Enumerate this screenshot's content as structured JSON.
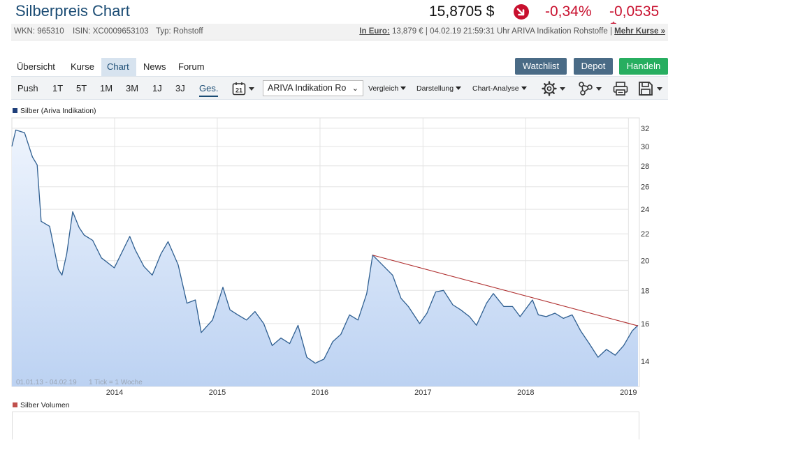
{
  "header": {
    "title": "Silberpreis Chart",
    "price": "15,8705 $",
    "change_pct": "-0,34%",
    "change_abs": "-0,0535 $",
    "trend_icon": "arrow-down-circle-icon",
    "trend_color": "#c8102e"
  },
  "info": {
    "wkn": "WKN: 965310",
    "isin": "ISIN: XC0009653103",
    "typ": "Typ: Rohstoff",
    "in_euro_label": "In Euro:",
    "in_euro_text": "13,879 € | 04.02.19 21:59:31 Uhr ARIVA Indikation Rohstoffe |",
    "mehr_kurse": "Mehr Kurse »"
  },
  "nav": {
    "tabs": [
      "Übersicht",
      "Kurse",
      "Chart",
      "News",
      "Forum"
    ],
    "active": "Chart"
  },
  "actions": {
    "watchlist": "Watchlist",
    "depot": "Depot",
    "handeln": "Handeln"
  },
  "toolbar": {
    "push": "Push",
    "ranges": [
      "1T",
      "5T",
      "1M",
      "3M",
      "1J",
      "3J",
      "Ges."
    ],
    "active_range": "Ges.",
    "calendar_day": "21",
    "source": "ARIVA Indikation Ro",
    "vergleich": "Vergleich",
    "darstellung": "Darstellung",
    "chart_analyse": "Chart-Analyse"
  },
  "footer_note": {
    "range": "01.01.13 - 04.02.19",
    "tick": "1 Tick = 1 Woche"
  },
  "colors": {
    "line": "#2f5f91",
    "fill_top": "#eef4fd",
    "fill_bottom": "#bcd2f2",
    "trendline": "#b03030",
    "silber_swatch": "#1f3f7a",
    "volumen_swatch": "#c0504d"
  },
  "chart_data": {
    "type": "area",
    "title": "",
    "series": [
      {
        "name": "Silber (Ariva Indikation)",
        "x": [
          "2013-01-01",
          "2013-01-15",
          "2013-02-15",
          "2013-03-15",
          "2013-04-01",
          "2013-04-15",
          "2013-05-15",
          "2013-06-15",
          "2013-06-28",
          "2013-07-15",
          "2013-08-05",
          "2013-08-28",
          "2013-09-15",
          "2013-10-15",
          "2013-11-15",
          "2013-12-31",
          "2014-01-15",
          "2014-02-24",
          "2014-03-15",
          "2014-04-15",
          "2014-05-15",
          "2014-06-15",
          "2014-07-10",
          "2014-08-15",
          "2014-09-15",
          "2014-10-15",
          "2014-11-05",
          "2014-12-15",
          "2015-01-21",
          "2015-02-15",
          "2015-03-15",
          "2015-04-15",
          "2015-05-15",
          "2015-06-15",
          "2015-07-15",
          "2015-08-15",
          "2015-09-15",
          "2015-10-15",
          "2015-11-15",
          "2015-12-15",
          "2016-01-15",
          "2016-02-15",
          "2016-03-15",
          "2016-04-15",
          "2016-05-15",
          "2016-06-15",
          "2016-07-06",
          "2016-08-15",
          "2016-09-15",
          "2016-10-15",
          "2016-11-10",
          "2016-12-20",
          "2017-01-15",
          "2017-02-15",
          "2017-03-15",
          "2017-04-17",
          "2017-05-15",
          "2017-06-15",
          "2017-07-10",
          "2017-08-15",
          "2017-09-08",
          "2017-10-15",
          "2017-11-15",
          "2017-12-12",
          "2018-01-25",
          "2018-02-15",
          "2018-03-15",
          "2018-04-15",
          "2018-05-15",
          "2018-06-15",
          "2018-07-15",
          "2018-08-15",
          "2018-09-15",
          "2018-10-15",
          "2018-11-15",
          "2018-12-15",
          "2019-01-15",
          "2019-02-04"
        ],
        "values": [
          30.0,
          31.8,
          31.5,
          28.9,
          28.1,
          23.0,
          22.6,
          19.4,
          19.0,
          20.5,
          23.8,
          22.5,
          21.9,
          21.5,
          20.2,
          19.5,
          20.1,
          21.8,
          20.8,
          19.6,
          19.0,
          20.5,
          21.4,
          19.7,
          17.2,
          17.4,
          15.5,
          16.2,
          18.2,
          16.8,
          16.5,
          16.2,
          16.7,
          16.0,
          14.8,
          15.2,
          14.9,
          15.9,
          14.2,
          13.9,
          14.1,
          15.0,
          15.4,
          16.5,
          16.2,
          17.8,
          20.4,
          19.6,
          19.0,
          17.5,
          17.0,
          16.0,
          16.6,
          17.9,
          18.0,
          17.1,
          16.8,
          16.4,
          15.9,
          17.2,
          17.8,
          17.0,
          17.0,
          16.4,
          17.4,
          16.5,
          16.4,
          16.6,
          16.3,
          16.5,
          15.6,
          14.9,
          14.2,
          14.6,
          14.3,
          14.8,
          15.6,
          15.9
        ]
      }
    ],
    "xlabel": "",
    "ylabel": "",
    "x_ticks": [
      "2014",
      "2015",
      "2016",
      "2017",
      "2018",
      "2019"
    ],
    "y_ticks": [
      14,
      16,
      18,
      20,
      22,
      24,
      26,
      28,
      30,
      32
    ],
    "ylim": [
      12.8,
      33.2
    ],
    "y_scale": "log",
    "xlim": [
      "2013-01-01",
      "2019-02-04"
    ],
    "trendline": {
      "from": [
        "2016-07-06",
        20.4
      ],
      "to": [
        "2019-02-04",
        15.87
      ]
    },
    "grid": true,
    "legend": "top-left",
    "volume_legend": "Silber Volumen"
  }
}
